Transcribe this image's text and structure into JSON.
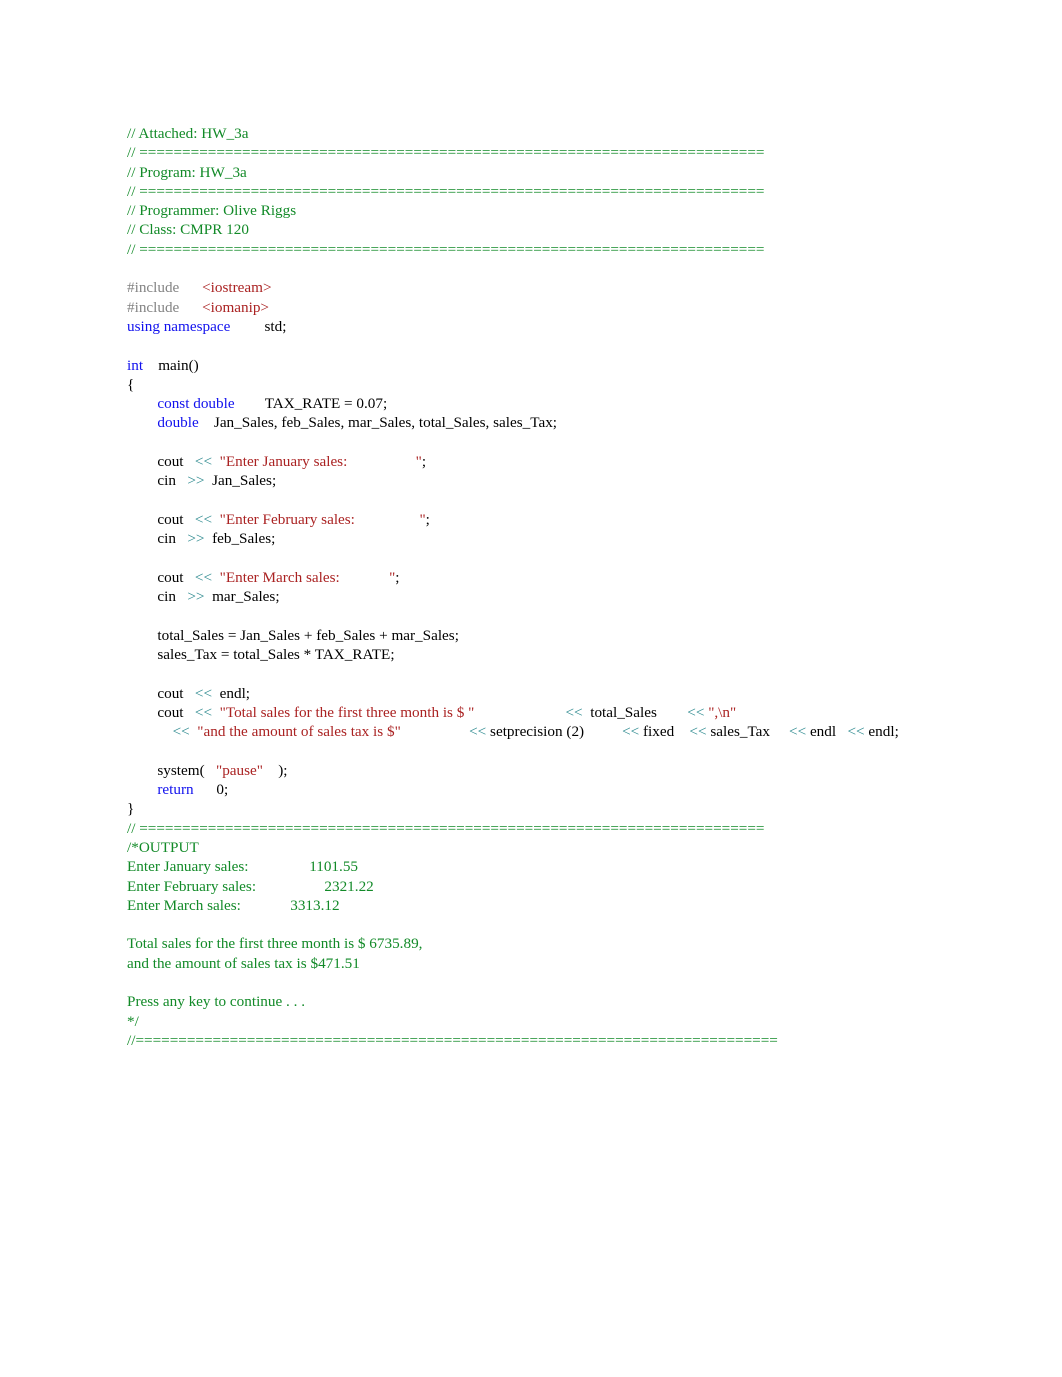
{
  "document": {
    "title": "HW_3a",
    "language": "C++",
    "colors": {
      "comment": "#128a28",
      "keyword": "#1111ee",
      "preprocessor": "#848484",
      "string": "#aa2222",
      "header": "#aa2222",
      "operator": "#2d8a8f",
      "plain": "#000000",
      "background": "#ffffff"
    },
    "separator_spaced": "// =========================================================================",
    "separator_tight": "//==========================================================================="
  },
  "header_block": {
    "attached": "// Attached: HW_3a",
    "program": "// Program: HW_3a",
    "programmer": "// Programmer: Olive Riggs",
    "class": "// Class: CMPR 120"
  },
  "code": {
    "include_directive": "#include",
    "include_iostream": "<iostream>",
    "include_iomanip": "<iomanip>",
    "using_namespace_kw": "using namespace",
    "using_namespace_value": "std;",
    "int_kw": "int",
    "main_decl": "main()",
    "open_brace": "{",
    "close_brace": "}",
    "const_double_kw": "const double",
    "tax_rate_decl": "TAX_RATE = 0.07;",
    "double_kw": "double",
    "variable_decl": "Jan_Sales, feb_Sales, mar_Sales, total_Sales, sales_Tax;",
    "cout": "cout",
    "cin": "cin",
    "insert_op": "<<",
    "extract_op": ">>",
    "prompt_january": "\"Enter January sales:                  \"",
    "semicolon": ";",
    "read_jan": "Jan_Sales;",
    "prompt_february": "\"Enter February sales:                 \"",
    "read_feb": "feb_Sales;",
    "prompt_march": "\"Enter March sales:             \"",
    "read_mar": "mar_Sales;",
    "calc_total": "total_Sales = Jan_Sales + feb_Sales + mar_Sales;",
    "calc_tax": "sales_Tax = total_Sales * TAX_RATE;",
    "endl": "endl;",
    "endl_plain": "endl",
    "total_msg": "\"Total sales for the first three month is $ \"",
    "total_sales_var": "total_Sales",
    "newline_literal": "\",\\n\"",
    "tax_msg": "\"and the amount of sales tax is $\"",
    "setprecision": "setprecision (2)",
    "fixed": "fixed",
    "sales_tax_var": "sales_Tax",
    "endl_last": "endl;",
    "system_call_open": "system(",
    "system_pause_arg": "\"pause\"",
    "system_call_close": ");",
    "return_kw": "return",
    "return_value": "0;"
  },
  "output_block": {
    "open_comment": "/*OUTPUT",
    "lines": [
      "Enter January sales:                1101.55",
      "Enter February sales:                  2321.22",
      "Enter March sales:             3313.12",
      "",
      "Total sales for the first three month is $ 6735.89,",
      "and the amount of sales tax is $471.51",
      "",
      "Press any key to continue . . ."
    ],
    "close_comment": "*/"
  }
}
